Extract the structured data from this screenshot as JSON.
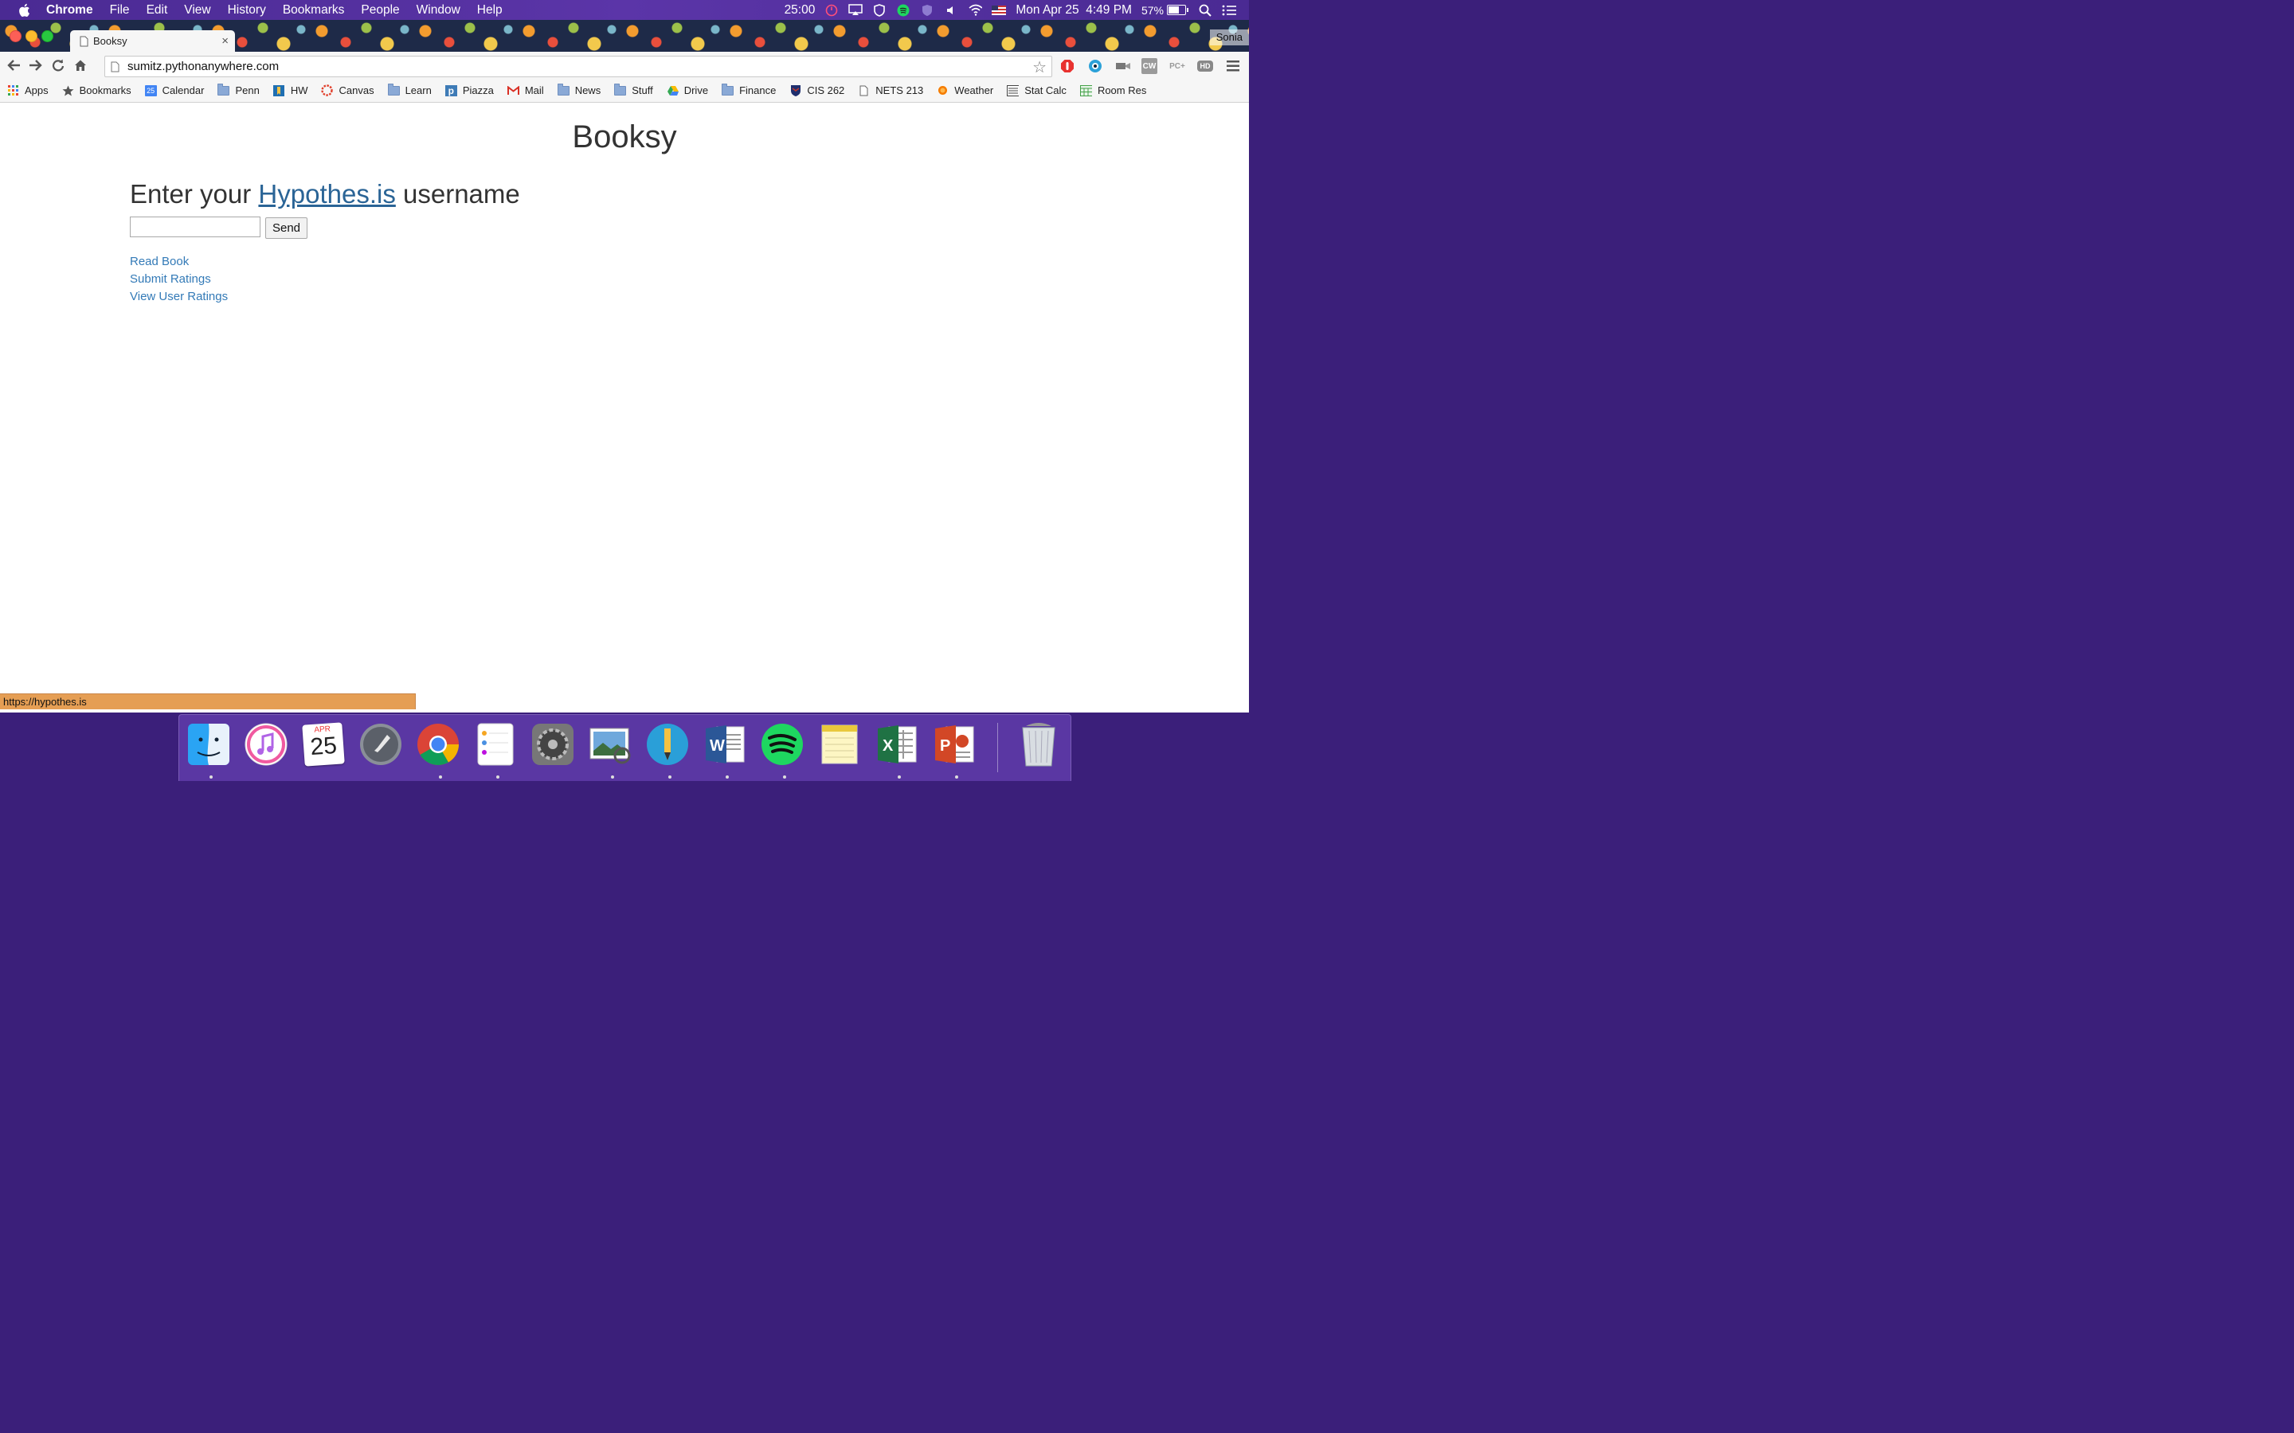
{
  "menubar": {
    "app_name": "Chrome",
    "menus": [
      "File",
      "Edit",
      "View",
      "History",
      "Bookmarks",
      "People",
      "Window",
      "Help"
    ],
    "timer": "25:00",
    "datetime": "Mon Apr 25  4:49 PM",
    "battery_text": "57%",
    "battery_level": 0.57
  },
  "browser": {
    "tab_title": "Booksy",
    "tab_close": "×",
    "profile_name": "Sonia",
    "url": "sumitz.pythonanywhere.com",
    "extensions": [
      "CW",
      "PC+",
      "HD"
    ],
    "bookmarks": [
      {
        "label": "Apps",
        "icon": "apps-grid-icon"
      },
      {
        "label": "Bookmarks",
        "icon": "star-icon"
      },
      {
        "label": "Calendar",
        "icon": "calendar-icon",
        "badge": "25"
      },
      {
        "label": "Penn",
        "icon": "folder-icon"
      },
      {
        "label": "HW",
        "icon": "hw-icon"
      },
      {
        "label": "Canvas",
        "icon": "canvas-icon"
      },
      {
        "label": "Learn",
        "icon": "folder-icon"
      },
      {
        "label": "Piazza",
        "icon": "piazza-icon"
      },
      {
        "label": "Mail",
        "icon": "gmail-icon"
      },
      {
        "label": "News",
        "icon": "folder-icon"
      },
      {
        "label": "Stuff",
        "icon": "folder-icon"
      },
      {
        "label": "Drive",
        "icon": "drive-icon"
      },
      {
        "label": "Finance",
        "icon": "folder-icon"
      },
      {
        "label": "CIS 262",
        "icon": "penn-shield-icon"
      },
      {
        "label": "NETS 213",
        "icon": "page-icon"
      },
      {
        "label": "Weather",
        "icon": "weather-icon"
      },
      {
        "label": "Stat Calc",
        "icon": "stat-calc-icon"
      },
      {
        "label": "Room Res",
        "icon": "room-res-icon"
      }
    ],
    "status_url": "https://hypothes.is"
  },
  "page": {
    "title": "Booksy",
    "prompt_before": "Enter your ",
    "prompt_link": "Hypothes.is",
    "prompt_after": " username",
    "input_value": "",
    "send_label": "Send",
    "links": [
      "Read Book",
      "Submit Ratings",
      "View User Ratings"
    ]
  },
  "dock": {
    "calendar_month": "APR",
    "calendar_day": "25",
    "apps": [
      "finder",
      "itunes",
      "calendar",
      "launchpad",
      "chrome",
      "reminders",
      "system-preferences",
      "preview",
      "pencil",
      "word",
      "spotify",
      "notes",
      "excel",
      "powerpoint",
      "trash"
    ]
  },
  "colors": {
    "link": "#337ab7",
    "heading_link": "#2a6496",
    "menubar": "#4a2a93",
    "status_bar": "#e59e54"
  }
}
